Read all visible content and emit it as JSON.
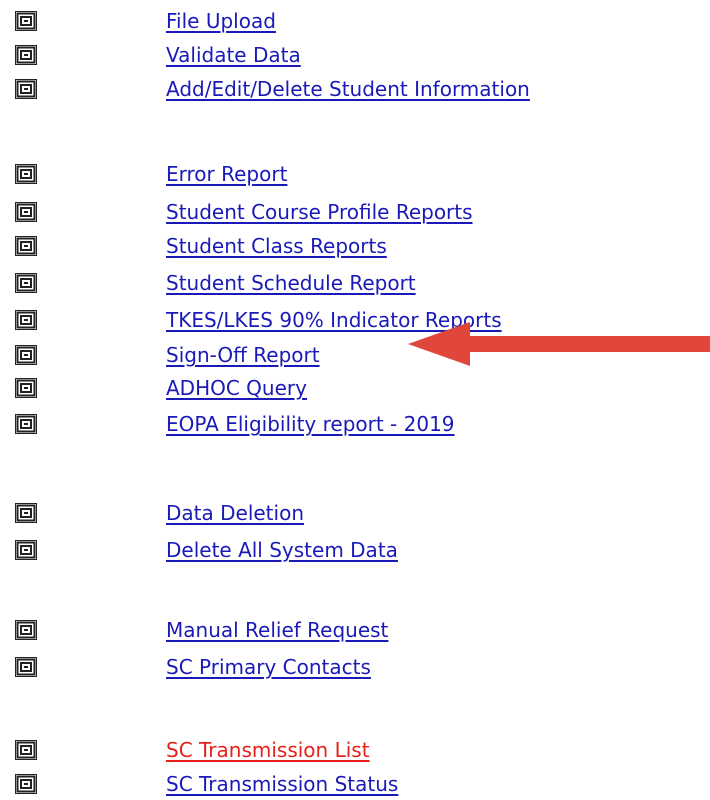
{
  "menu": {
    "items": [
      {
        "label": "File Upload",
        "icon": "report-icon"
      },
      {
        "label": "Validate Data",
        "icon": "report-icon"
      },
      {
        "label": "Add/Edit/Delete Student Information",
        "icon": "report-icon"
      },
      {
        "label": "Error Report",
        "icon": "report-icon"
      },
      {
        "label": "Student Course Profile Reports",
        "icon": "report-icon"
      },
      {
        "label": "Student Class Reports",
        "icon": "report-icon"
      },
      {
        "label": "Student Schedule Report",
        "icon": "report-icon"
      },
      {
        "label": "TKES/LKES 90% Indicator Reports",
        "icon": "report-icon"
      },
      {
        "label": "Sign-Off Report",
        "icon": "report-icon"
      },
      {
        "label": "ADHOC Query",
        "icon": "report-icon"
      },
      {
        "label": "EOPA Eligibility report - 2019",
        "icon": "report-icon"
      },
      {
        "label": "Data Deletion",
        "icon": "report-icon"
      },
      {
        "label": "Delete All System Data",
        "icon": "report-icon"
      },
      {
        "label": "Manual Relief Request",
        "icon": "report-icon"
      },
      {
        "label": "SC Primary Contacts",
        "icon": "report-icon"
      },
      {
        "label": "SC Transmission List",
        "icon": "report-icon",
        "color": "#e8201a"
      },
      {
        "label": "SC Transmission Status",
        "icon": "report-icon"
      }
    ]
  },
  "colors": {
    "link": "#1a1ab8",
    "link_highlight": "#e8201a",
    "arrow": "#e0473a"
  },
  "annotation": {
    "type": "arrow",
    "points_to": "Sign-Off Report"
  }
}
